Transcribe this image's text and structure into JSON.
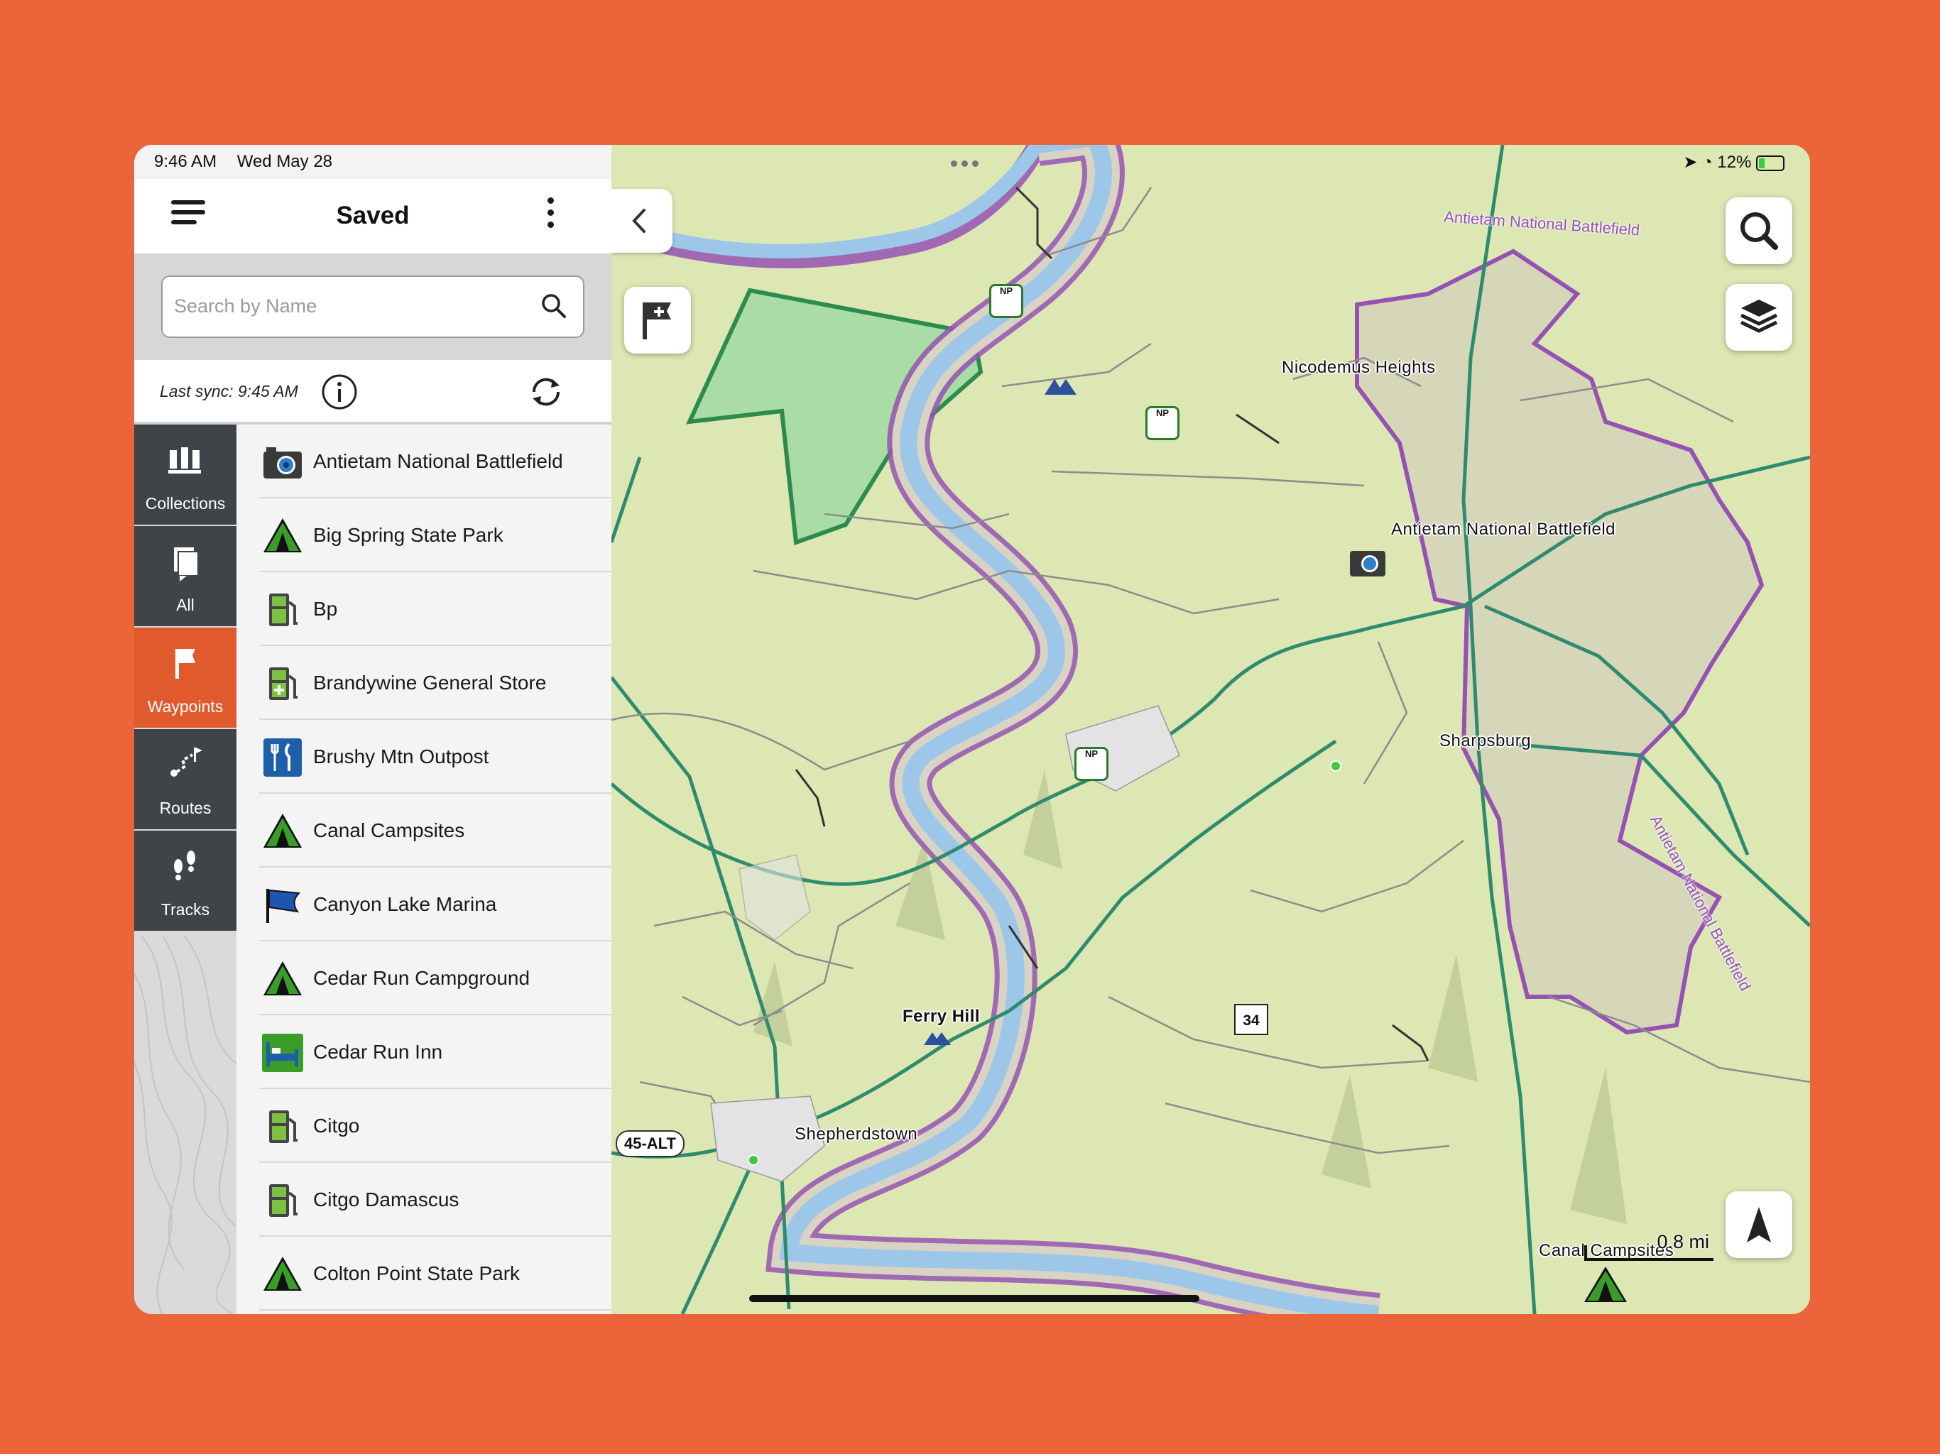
{
  "status": {
    "time": "9:46 AM",
    "date": "Wed May 28",
    "battery": "12%"
  },
  "header": {
    "title": "Saved"
  },
  "search": {
    "placeholder": "Search by Name"
  },
  "sync": {
    "text": "Last sync: 9:45 AM"
  },
  "tabs": [
    {
      "label": "Collections",
      "icon": "collections-icon",
      "active": false
    },
    {
      "label": "All",
      "icon": "all-icon",
      "active": false
    },
    {
      "label": "Waypoints",
      "icon": "flag-icon",
      "active": true
    },
    {
      "label": "Routes",
      "icon": "route-icon",
      "active": false
    },
    {
      "label": "Tracks",
      "icon": "footprints-icon",
      "active": false
    }
  ],
  "waypoints": [
    {
      "name": "Antietam National Battlefield",
      "icon": "camera-icon"
    },
    {
      "name": "Big Spring State Park",
      "icon": "tent-icon"
    },
    {
      "name": "Bp",
      "icon": "fuel-icon"
    },
    {
      "name": "Brandywine General Store",
      "icon": "fuel-store-icon"
    },
    {
      "name": "Brushy Mtn Outpost",
      "icon": "restaurant-icon"
    },
    {
      "name": "Canal Campsites",
      "icon": "tent-icon"
    },
    {
      "name": "Canyon Lake Marina",
      "icon": "marina-flag-icon"
    },
    {
      "name": "Cedar Run Campground",
      "icon": "tent-icon"
    },
    {
      "name": "Cedar Run Inn",
      "icon": "lodging-icon"
    },
    {
      "name": "Citgo",
      "icon": "fuel-icon"
    },
    {
      "name": "Citgo Damascus",
      "icon": "fuel-icon"
    },
    {
      "name": "Colton Point State Park",
      "icon": "tent-icon"
    }
  ],
  "map": {
    "labels": {
      "nicodemus": "Nicodemus Heights",
      "antietam": "Antietam National Battlefield",
      "sharpsburg": "Sharpsburg",
      "ferry_hill": "Ferry Hill",
      "shepherdstown": "Shepherdstown",
      "canal": "Canal Campsites",
      "antietam_boundary_top": "Antietam National Battlefield",
      "antietam_boundary_side": "Antietam National Battlefield"
    },
    "route_shield": "45-ALT",
    "route_34": "34",
    "np_text": "NP",
    "scale": "0.8 mi"
  },
  "colors": {
    "accent": "#E05A2E",
    "background": "#EC6439",
    "tabbar": "#3E4447",
    "river": "#9CC7E8",
    "boundary": "#9652B3",
    "road": "#2E8B6E"
  }
}
